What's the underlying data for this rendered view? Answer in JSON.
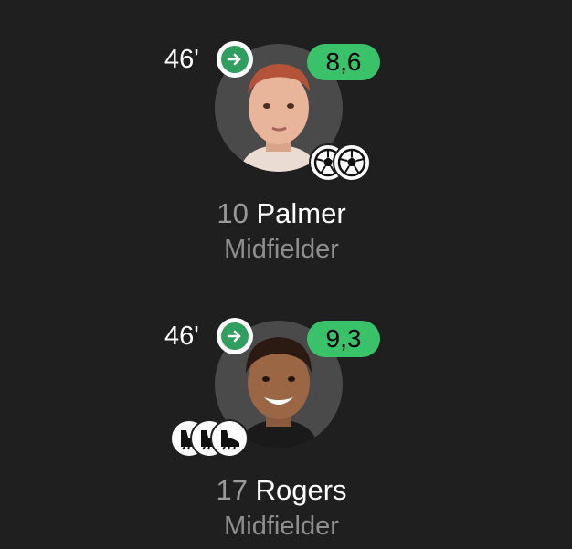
{
  "players": [
    {
      "minute": "46'",
      "rating": "8,6",
      "number": "10",
      "name": "Palmer",
      "position": "Midfielder",
      "events": [
        "goal-icon",
        "goal-icon"
      ],
      "rating_color": "#3ac26a"
    },
    {
      "minute": "46'",
      "rating": "9,3",
      "number": "17",
      "name": "Rogers",
      "position": "Midfielder",
      "events": [
        "assist-boot-icon",
        "assist-boot-icon",
        "assist-boot-icon"
      ],
      "rating_color": "#3ac26a"
    }
  ],
  "colors": {
    "background": "#1f1f1f",
    "sub_icon": "#2f9e5f",
    "rating_badge": "#3ac26a"
  }
}
